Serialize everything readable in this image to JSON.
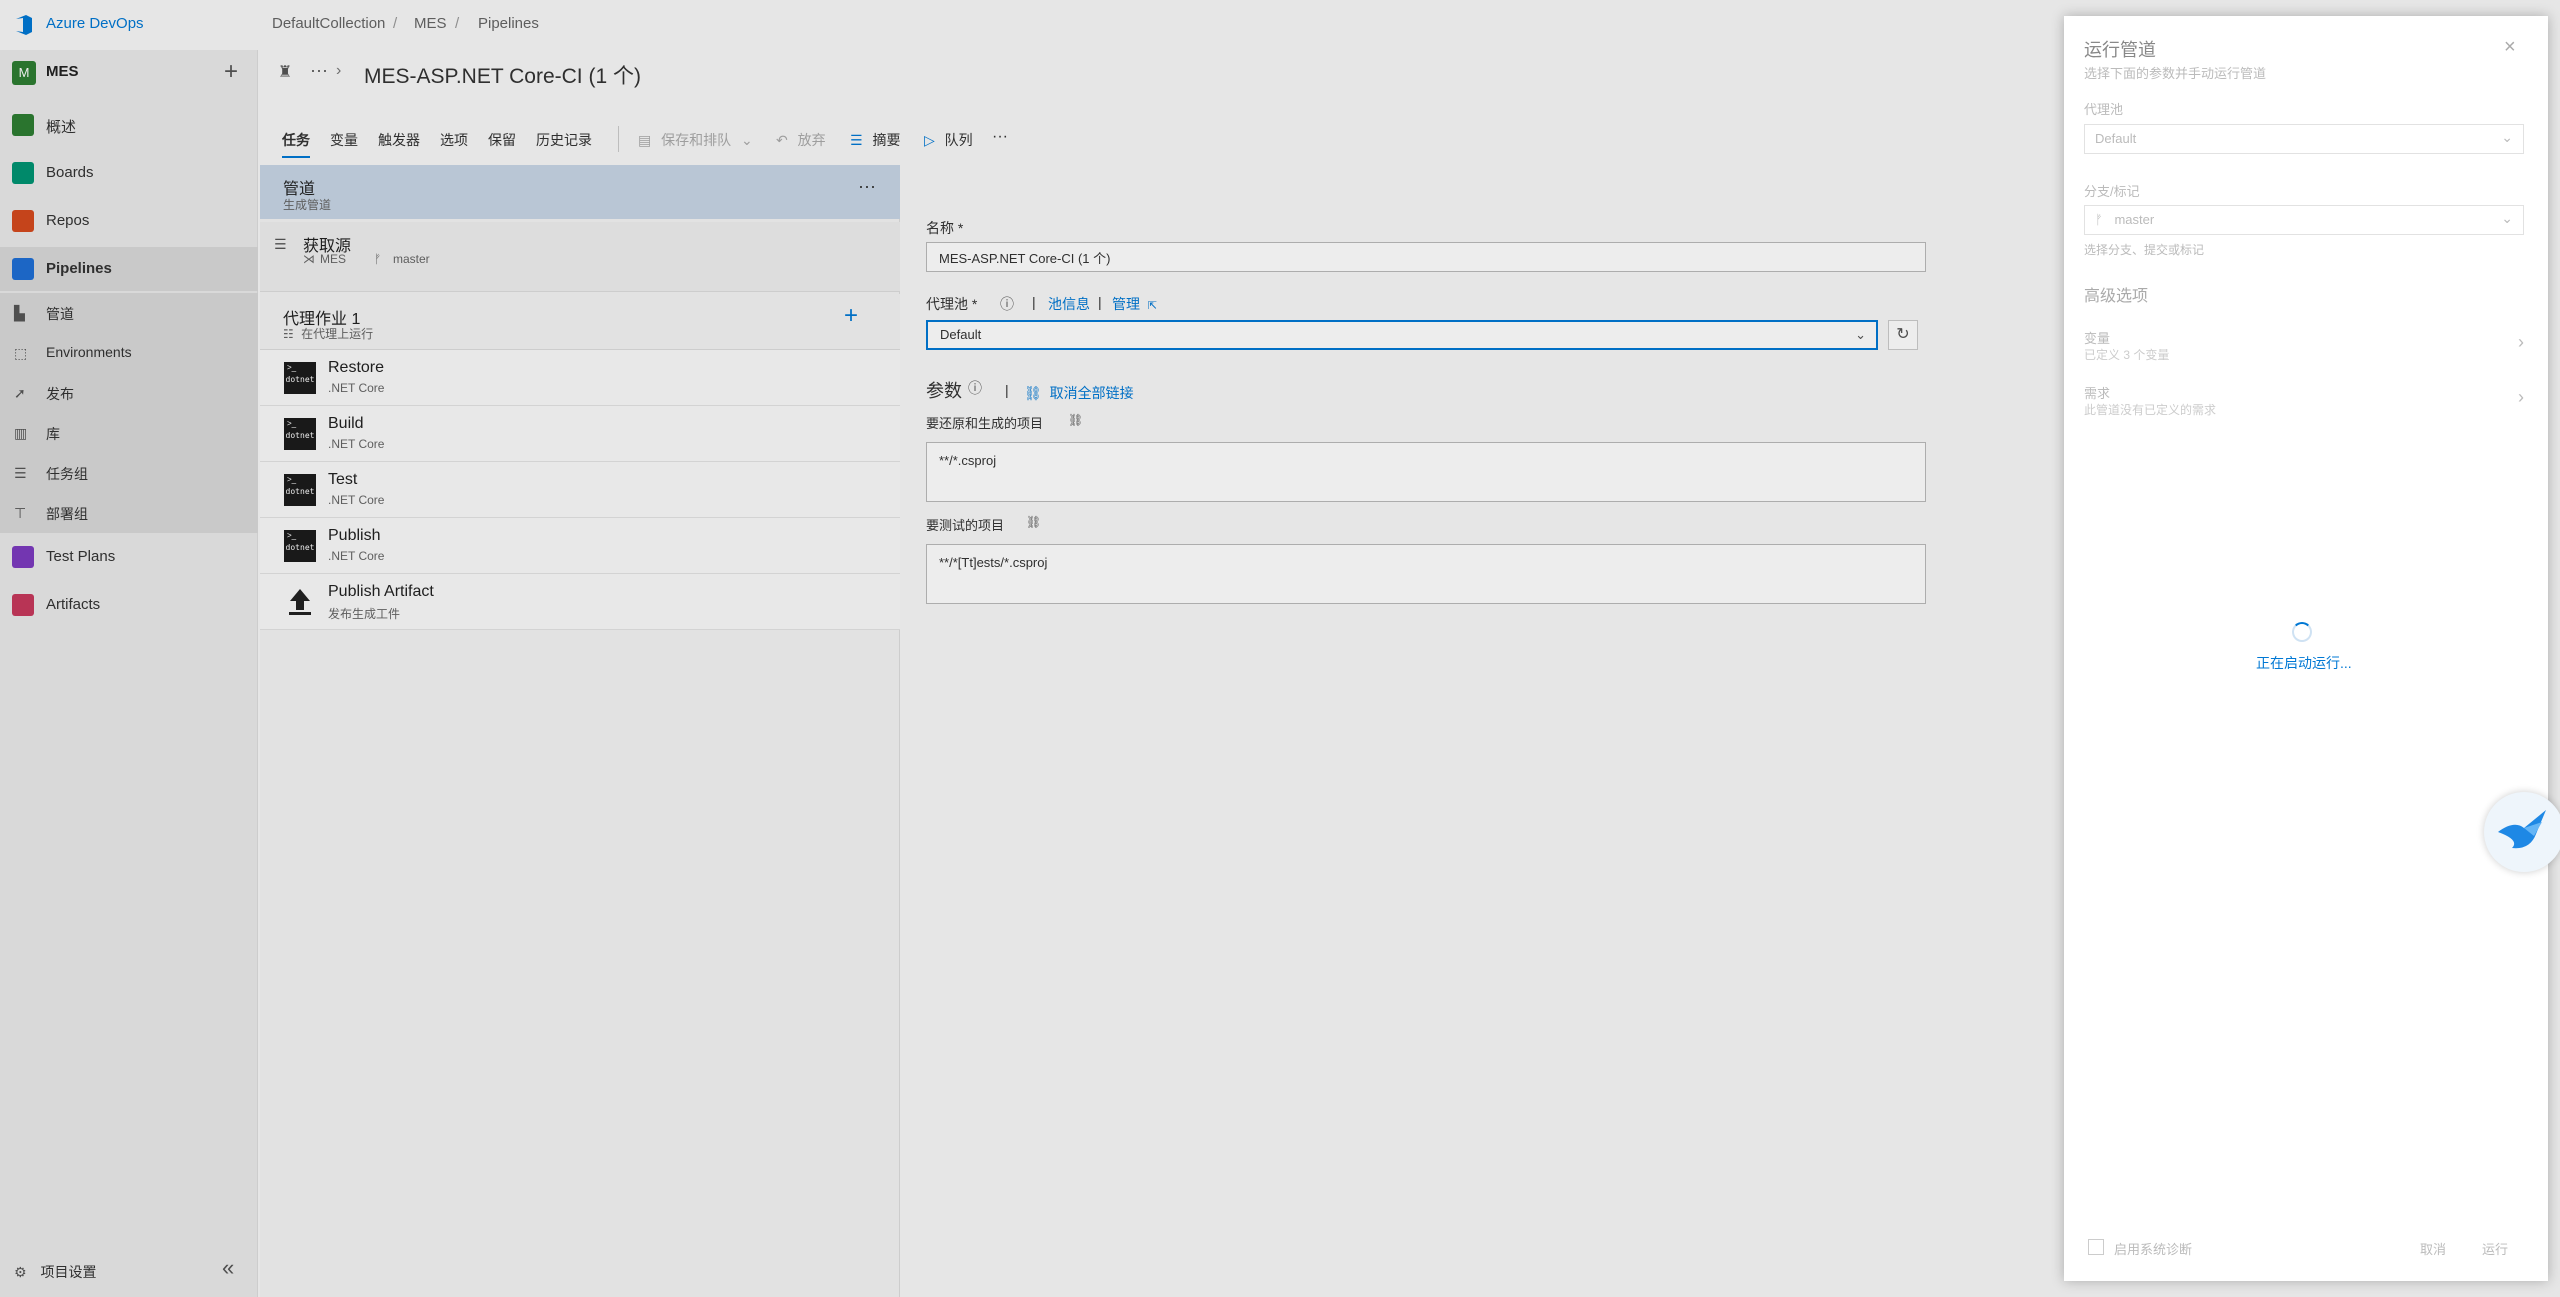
{
  "topbar": {
    "brand": "Azure DevOps",
    "breadcrumb": [
      "DefaultCollection",
      "/",
      "MES",
      "/",
      "Pipelines"
    ]
  },
  "project": {
    "avatar": "M",
    "name": "MES",
    "add": "+"
  },
  "nav": {
    "items": [
      {
        "label": "概述",
        "icon": "overview-icon",
        "color": "#2e7d32"
      },
      {
        "label": "Boards",
        "icon": "boards-icon",
        "color": "#009473"
      },
      {
        "label": "Repos",
        "icon": "repos-icon",
        "color": "#d44a1e"
      },
      {
        "label": "Pipelines",
        "icon": "pipelines-icon",
        "color": "#1f6ed4"
      }
    ],
    "pipeline_sub": [
      {
        "label": "管道",
        "icon": "pipeline-sub-icon"
      },
      {
        "label": "Environments",
        "icon": "environments-icon"
      },
      {
        "label": "发布",
        "icon": "release-icon"
      },
      {
        "label": "库",
        "icon": "library-icon"
      },
      {
        "label": "任务组",
        "icon": "task-groups-icon"
      },
      {
        "label": "部署组",
        "icon": "deployment-groups-icon"
      }
    ],
    "more": [
      {
        "label": "Test Plans",
        "icon": "test-plans-icon",
        "color": "#7c3bbf"
      },
      {
        "label": "Artifacts",
        "icon": "artifacts-icon",
        "color": "#c6385c"
      }
    ],
    "settings": "项目设置",
    "collapse": "«"
  },
  "header": {
    "title": "MES-ASP.NET Core-CI (1 个)"
  },
  "toolbar": {
    "tabs": [
      "任务",
      "变量",
      "触发器",
      "选项",
      "保留",
      "历史记录"
    ],
    "save_queue": "保存和排队",
    "discard": "放弃",
    "summary": "摘要",
    "queue": "队列",
    "more": "···"
  },
  "tasks": {
    "pipeline": {
      "title": "管道",
      "subtitle": "生成管道"
    },
    "source": {
      "title": "获取源",
      "repo": "MES",
      "branch": "master"
    },
    "job": {
      "title": "代理作业 1",
      "subtitle": "在代理上运行"
    },
    "items": [
      {
        "name": "Restore",
        "sub": ".NET Core",
        "icon": "dotnet"
      },
      {
        "name": "Build",
        "sub": ".NET Core",
        "icon": "dotnet"
      },
      {
        "name": "Test",
        "sub": ".NET Core",
        "icon": "dotnet"
      },
      {
        "name": "Publish",
        "sub": ".NET Core",
        "icon": "dotnet"
      },
      {
        "name": "Publish Artifact",
        "sub": "发布生成工件",
        "icon": "upload"
      }
    ]
  },
  "form": {
    "name_label": "名称 *",
    "name_value": "MES-ASP.NET Core-CI (1 个)",
    "pool_label": "代理池 *",
    "pool_info": "池信息",
    "pool_manage": "管理",
    "pool_value": "Default",
    "params_label": "参数",
    "unlink_all": "取消全部链接",
    "restore_label": "要还原和生成的项目",
    "restore_value": "**/*.csproj",
    "test_label": "要测试的项目",
    "test_value": "**/*[Tt]ests/*.csproj"
  },
  "dialog": {
    "title": "运行管道",
    "subtitle": "选择下面的参数并手动运行管道",
    "pool_label": "代理池",
    "pool_value": "Default",
    "branch_label": "分支/标记",
    "branch_value": "master",
    "branch_hint": "选择分支、提交或标记",
    "advanced": "高级选项",
    "variables_title": "变量",
    "variables_sub": "已定义 3 个变量",
    "demands_title": "需求",
    "demands_sub": "此管道没有已定义的需求",
    "loading": "正在启动运行...",
    "diag_label": "启用系统诊断",
    "cancel": "取消",
    "run": "运行",
    "close": "×"
  }
}
